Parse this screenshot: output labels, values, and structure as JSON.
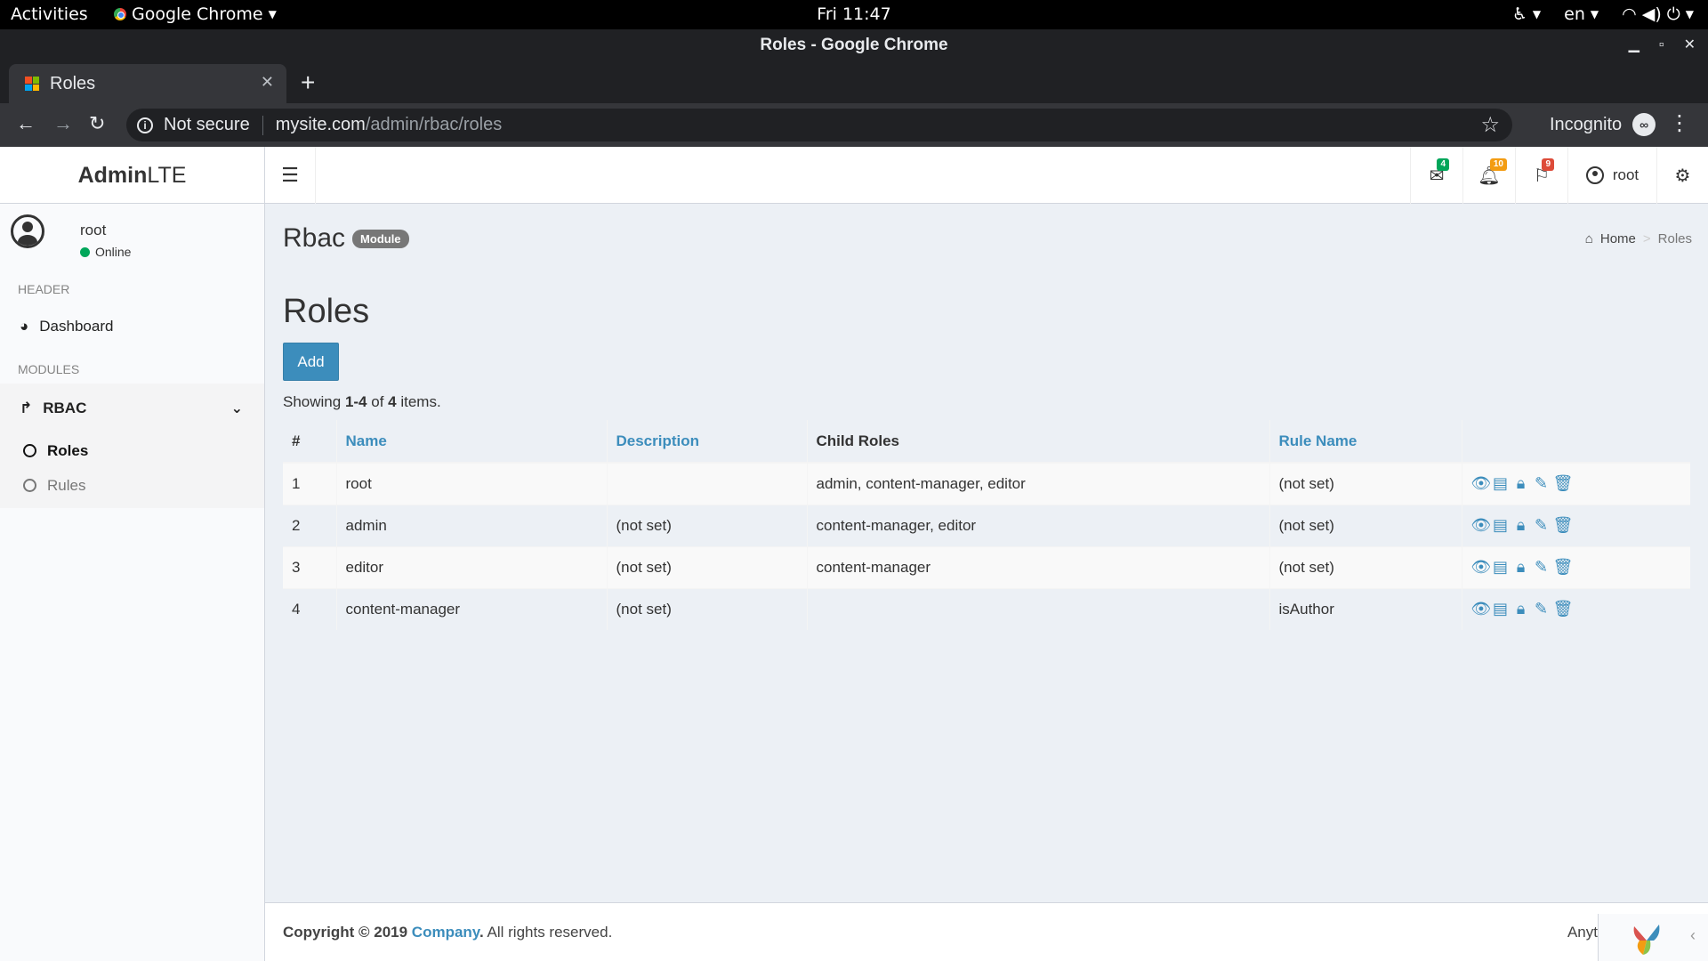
{
  "os": {
    "activities": "Activities",
    "app_menu": "Google Chrome",
    "clock": "Fri 11:47",
    "lang": "en"
  },
  "window": {
    "title": "Roles - Google Chrome"
  },
  "tab": {
    "title": "Roles"
  },
  "address": {
    "security": "Not secure",
    "host": "mysite.com",
    "path": "/admin/rbac/roles",
    "incognito": "Incognito"
  },
  "sidebar": {
    "logo_bold": "Admin",
    "logo_rest": "LTE",
    "user_name": "root",
    "user_status": "Online",
    "header_label": "HEADER",
    "dashboard": "Dashboard",
    "modules_label": "MODULES",
    "rbac": "RBAC",
    "roles": "Roles",
    "rules": "Rules"
  },
  "topnav": {
    "messages_count": "4",
    "notifications_count": "10",
    "tasks_count": "9",
    "user": "root",
    "colors": {
      "green": "#00a65a",
      "orange": "#f39c12",
      "red": "#dd4b39"
    }
  },
  "content": {
    "title": "Rbac",
    "badge": "Module",
    "breadcrumb_home": "Home",
    "breadcrumb_current": "Roles",
    "heading": "Roles",
    "add_button": "Add",
    "summary_prefix": "Showing ",
    "summary_range": "1-4",
    "summary_mid": " of ",
    "summary_total": "4",
    "summary_suffix": " items."
  },
  "table": {
    "headers": [
      "#",
      "Name",
      "Description",
      "Child Roles",
      "Rule Name"
    ],
    "rows": [
      {
        "num": "1",
        "name": "root",
        "description": "",
        "children": "admin, content-manager, editor",
        "rule": "(not set)"
      },
      {
        "num": "2",
        "name": "admin",
        "description": "(not set)",
        "children": "content-manager, editor",
        "rule": "(not set)"
      },
      {
        "num": "3",
        "name": "editor",
        "description": "(not set)",
        "children": "content-manager",
        "rule": "(not set)"
      },
      {
        "num": "4",
        "name": "content-manager",
        "description": "(not set)",
        "children": "",
        "rule": "isAuthor"
      }
    ],
    "action_icons": [
      "eye-icon",
      "list-icon",
      "lock-icon",
      "pencil-icon",
      "trash-icon"
    ]
  },
  "footer": {
    "copyright": "Copyright © 2019 ",
    "company": "Company",
    "rights": " All rights reserved.",
    "right_text": "Anyt"
  }
}
